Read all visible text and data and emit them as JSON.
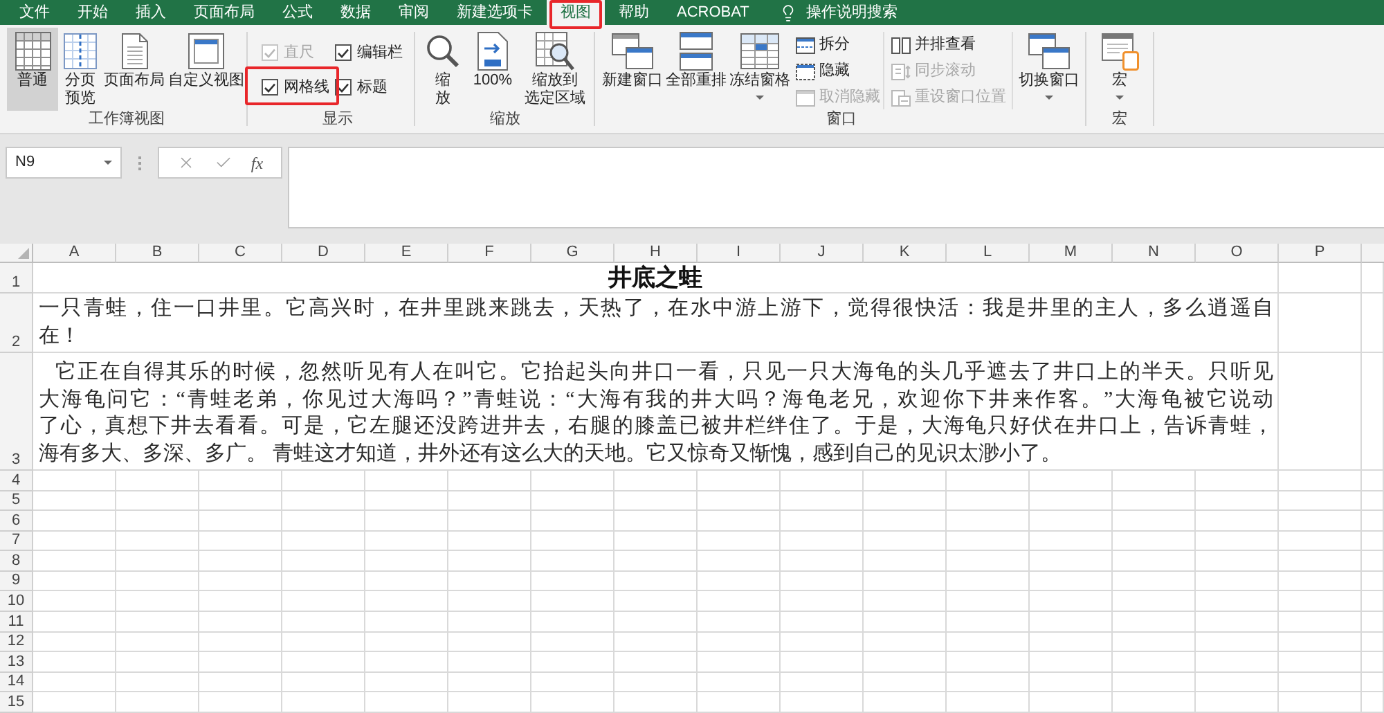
{
  "menu_tabs": [
    {
      "label": "文件",
      "selected": false,
      "annotated": false
    },
    {
      "label": "开始",
      "selected": false,
      "annotated": false
    },
    {
      "label": "插入",
      "selected": false,
      "annotated": false
    },
    {
      "label": "页面布局",
      "selected": false,
      "annotated": false
    },
    {
      "label": "公式",
      "selected": false,
      "annotated": false
    },
    {
      "label": "数据",
      "selected": false,
      "annotated": false
    },
    {
      "label": "审阅",
      "selected": false,
      "annotated": false
    },
    {
      "label": "新建选项卡",
      "selected": false,
      "annotated": false
    },
    {
      "label": "视图",
      "selected": true,
      "annotated": true
    },
    {
      "label": "帮助",
      "selected": false,
      "annotated": false
    },
    {
      "label": "ACROBAT",
      "selected": false,
      "annotated": false
    }
  ],
  "tell_me": {
    "label": "操作说明搜索"
  },
  "ribbon": {
    "workbook_views": {
      "label": "工作簿视图",
      "buttons": [
        {
          "lines": [
            "普通"
          ],
          "selected": true
        },
        {
          "lines": [
            "分页",
            "预览"
          ],
          "selected": false
        },
        {
          "lines": [
            "页面布局"
          ],
          "selected": false
        },
        {
          "lines": [
            "自定义视图"
          ],
          "selected": false
        }
      ]
    },
    "show": {
      "label": "显示",
      "checkboxes": [
        {
          "label": "直尺",
          "checked": true,
          "disabled": true,
          "annotated": false
        },
        {
          "label": "编辑栏",
          "checked": true,
          "disabled": false,
          "annotated": false
        },
        {
          "label": "网格线",
          "checked": true,
          "disabled": false,
          "annotated": true
        },
        {
          "label": "标题",
          "checked": true,
          "disabled": false,
          "annotated": false
        }
      ]
    },
    "zoom": {
      "label": "缩放",
      "buttons": [
        {
          "lines": [
            "缩",
            "放"
          ]
        },
        {
          "lines": [
            "100%"
          ]
        },
        {
          "lines": [
            "缩放到",
            "选定区域"
          ]
        }
      ]
    },
    "window": {
      "label": "窗口",
      "large_buttons": [
        {
          "lines": [
            "新建窗口"
          ]
        },
        {
          "lines": [
            "全部重排"
          ]
        },
        {
          "lines": [
            "冻结窗格"
          ],
          "dropdown": true
        }
      ],
      "small_buttons": [
        {
          "label": "拆分",
          "disabled": false
        },
        {
          "label": "隐藏",
          "disabled": false
        },
        {
          "label": "取消隐藏",
          "disabled": true
        }
      ],
      "side_by_side_buttons": [
        {
          "label": "并排查看",
          "disabled": false
        },
        {
          "label": "同步滚动",
          "disabled": true
        },
        {
          "label": "重设窗口位置",
          "disabled": true
        }
      ],
      "switch_button": {
        "lines": [
          "切换窗口"
        ],
        "dropdown": true
      }
    },
    "macros": {
      "label": "宏",
      "button": {
        "lines": [
          "宏"
        ],
        "dropdown": true
      }
    }
  },
  "formula_bar": {
    "name_box": "N9",
    "function_label": "fx"
  },
  "sheet": {
    "columns": [
      "A",
      "B",
      "C",
      "D",
      "E",
      "F",
      "G",
      "H",
      "I",
      "J",
      "K",
      "L",
      "M",
      "N",
      "O",
      "P"
    ],
    "rows": [
      {
        "label": "1",
        "kind": "title",
        "text": "井底之蛙"
      },
      {
        "label": "2",
        "kind": "paragraph",
        "lines": [
          "一只青蛙，住一口井里。它高兴时，在井里跳来跳去，天热了，在水中游上游下，觉得很快活：我是井里的主人，多么逍遥自",
          "在！"
        ]
      },
      {
        "label": "3",
        "kind": "indented_paragraph",
        "lines": [
          "它正在自得其乐的时候，忽然听见有人在叫它。它抬起头向井口一看，只见一只大海龟的头几乎遮去了井口上的半天。只听见",
          "大海龟问它：“青蛙老弟，你见过大海吗？”青蛙说：“大海有我的井大吗？海龟老兄，欢迎你下井来作客。”大海龟被它说动",
          "了心，真想下井去看看。可是，它左腿还没跨进井去，右腿的膝盖已被井栏绊住了。于是，大海龟只好伏在井口上，告诉青蛙，",
          "海有多大、多深、多广。 青蛙这才知道，井外还有这么大的天地。它又惊奇又惭愧，感到自己的见识太渺小了。"
        ]
      },
      {
        "label": "4",
        "kind": "empty"
      },
      {
        "label": "5",
        "kind": "empty"
      },
      {
        "label": "6",
        "kind": "empty"
      },
      {
        "label": "7",
        "kind": "empty"
      },
      {
        "label": "8",
        "kind": "empty"
      },
      {
        "label": "9",
        "kind": "empty"
      },
      {
        "label": "10",
        "kind": "empty"
      },
      {
        "label": "11",
        "kind": "empty"
      },
      {
        "label": "12",
        "kind": "empty"
      },
      {
        "label": "13",
        "kind": "empty"
      },
      {
        "label": "14",
        "kind": "empty"
      },
      {
        "label": "15",
        "kind": "empty"
      }
    ]
  }
}
